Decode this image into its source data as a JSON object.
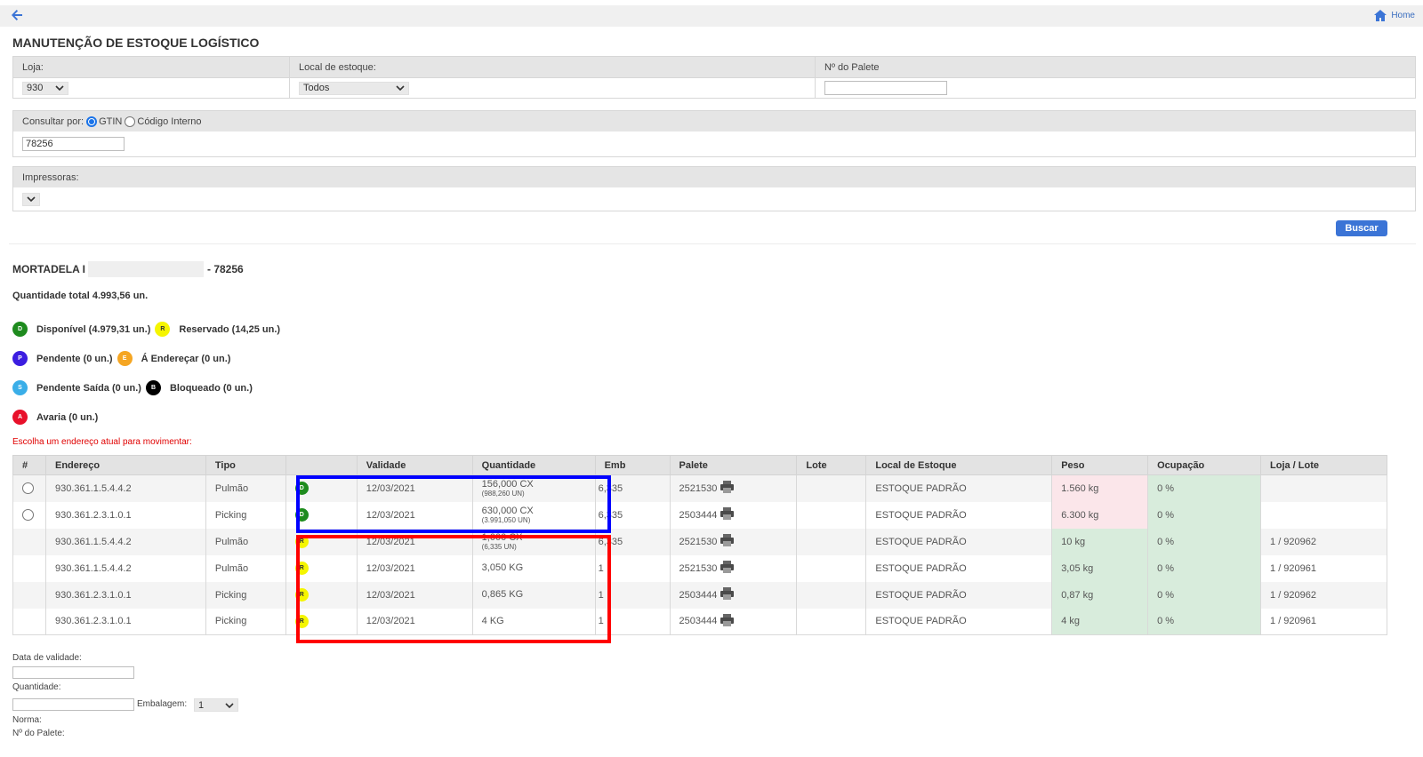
{
  "header": {
    "home_label": "Home"
  },
  "page": {
    "title": "MANUTENÇÃO DE ESTOQUE LOGÍSTICO"
  },
  "filters": {
    "loja_label": "Loja:",
    "loja_value": "930",
    "local_label": "Local de estoque:",
    "local_value": "Todos",
    "palete_label": "Nº do Palete",
    "palete_value": "",
    "consultar_label": "Consultar por:",
    "option_gtin": "GTIN",
    "option_codigo": "Código Interno",
    "search_value": "78256",
    "impressoras_label": "Impressoras:",
    "buscar_label": "Buscar"
  },
  "product": {
    "name": "MORTADELA I",
    "code": "- 78256",
    "total": "Quantidade total 4.993,56 un."
  },
  "legend": [
    [
      {
        "letter": "D",
        "text": "Disponível (4.979,31 un.)",
        "color": "#1e8b1e",
        "fg": "#ffffff"
      },
      {
        "letter": "R",
        "text": "Reservado (14,25 un.)",
        "color": "#f5f500",
        "fg": "#333333"
      }
    ],
    [
      {
        "letter": "P",
        "text": "Pendente (0 un.)",
        "color": "#3b1de0",
        "fg": "#ffffff"
      },
      {
        "letter": "E",
        "text": "Á Endereçar (0 un.)",
        "color": "#f5a623",
        "fg": "#ffffff"
      }
    ],
    [
      {
        "letter": "S",
        "text": "Pendente Saída (0 un.)",
        "color": "#3aaee8",
        "fg": "#ffffff"
      },
      {
        "letter": "B",
        "text": "Bloqueado (0 un.)",
        "color": "#000000",
        "fg": "#ffffff"
      }
    ],
    [
      {
        "letter": "A",
        "text": "Avaria (0 un.)",
        "color": "#e8102a",
        "fg": "#ffffff"
      }
    ]
  ],
  "choose_msg": "Escolha um endereço atual para movimentar:",
  "table": {
    "headers": [
      "#",
      "Endereço",
      "Tipo",
      "",
      "Validade",
      "Quantidade",
      "Emb",
      "Palete",
      "Lote",
      "Local de Estoque",
      "Peso",
      "Ocupação",
      "Loja / Lote"
    ],
    "rows": [
      {
        "radio": true,
        "endereco": "930.361.1.5.4.4.2",
        "tipo": "Pulmão",
        "status": "D",
        "validade": "12/03/2021",
        "qty": "156,000 CX",
        "qty_sub": "(988,260 UN)",
        "emb": "6,335",
        "palete": "2521530",
        "lote": "",
        "local": "ESTOQUE PADRÃO",
        "peso": "1.560 kg",
        "peso_state": "warn",
        "ocupacao": "0 %",
        "loja_lote": ""
      },
      {
        "radio": true,
        "endereco": "930.361.2.3.1.0.1",
        "tipo": "Picking",
        "status": "D",
        "validade": "12/03/2021",
        "qty": "630,000 CX",
        "qty_sub": "(3.991,050 UN)",
        "emb": "6,335",
        "palete": "2503444",
        "lote": "",
        "local": "ESTOQUE PADRÃO",
        "peso": "6.300 kg",
        "peso_state": "warn",
        "ocupacao": "0 %",
        "loja_lote": ""
      },
      {
        "radio": false,
        "endereco": "930.361.1.5.4.4.2",
        "tipo": "Pulmão",
        "status": "R",
        "validade": "12/03/2021",
        "qty": "1,000 CX",
        "qty_sub": "(6,335 UN)",
        "emb": "6,335",
        "palete": "2521530",
        "lote": "",
        "local": "ESTOQUE PADRÃO",
        "peso": "10 kg",
        "peso_state": "ok",
        "ocupacao": "0 %",
        "loja_lote": "1 / 920962"
      },
      {
        "radio": false,
        "endereco": "930.361.1.5.4.4.2",
        "tipo": "Pulmão",
        "status": "R",
        "validade": "12/03/2021",
        "qty": "3,050 KG",
        "qty_sub": "",
        "emb": "1",
        "palete": "2521530",
        "lote": "",
        "local": "ESTOQUE PADRÃO",
        "peso": "3,05 kg",
        "peso_state": "ok",
        "ocupacao": "0 %",
        "loja_lote": "1 / 920961"
      },
      {
        "radio": false,
        "endereco": "930.361.2.3.1.0.1",
        "tipo": "Picking",
        "status": "R",
        "validade": "12/03/2021",
        "qty": "0,865 KG",
        "qty_sub": "",
        "emb": "1",
        "palete": "2503444",
        "lote": "",
        "local": "ESTOQUE PADRÃO",
        "peso": "0,87 kg",
        "peso_state": "ok",
        "ocupacao": "0 %",
        "loja_lote": "1 / 920962"
      },
      {
        "radio": false,
        "endereco": "930.361.2.3.1.0.1",
        "tipo": "Picking",
        "status": "R",
        "validade": "12/03/2021",
        "qty": "4 KG",
        "qty_sub": "",
        "emb": "1",
        "palete": "2503444",
        "lote": "",
        "local": "ESTOQUE PADRÃO",
        "peso": "4 kg",
        "peso_state": "ok",
        "ocupacao": "0 %",
        "loja_lote": "1 / 920961"
      }
    ]
  },
  "status_colors": {
    "D": {
      "bg": "#1e8b1e",
      "fg": "#ffffff"
    },
    "R": {
      "bg": "#f5f500",
      "fg": "#333333"
    }
  },
  "highlight_colors": {
    "blue": "#0000ff",
    "red": "#ff0000"
  },
  "move_form": {
    "validade_label": "Data de validade:",
    "quantidade_label": "Quantidade:",
    "embalagem_label": "Embalagem:",
    "embalagem_value": "1",
    "norma_label": "Norma:",
    "palete_label": "Nº do Palete:"
  }
}
